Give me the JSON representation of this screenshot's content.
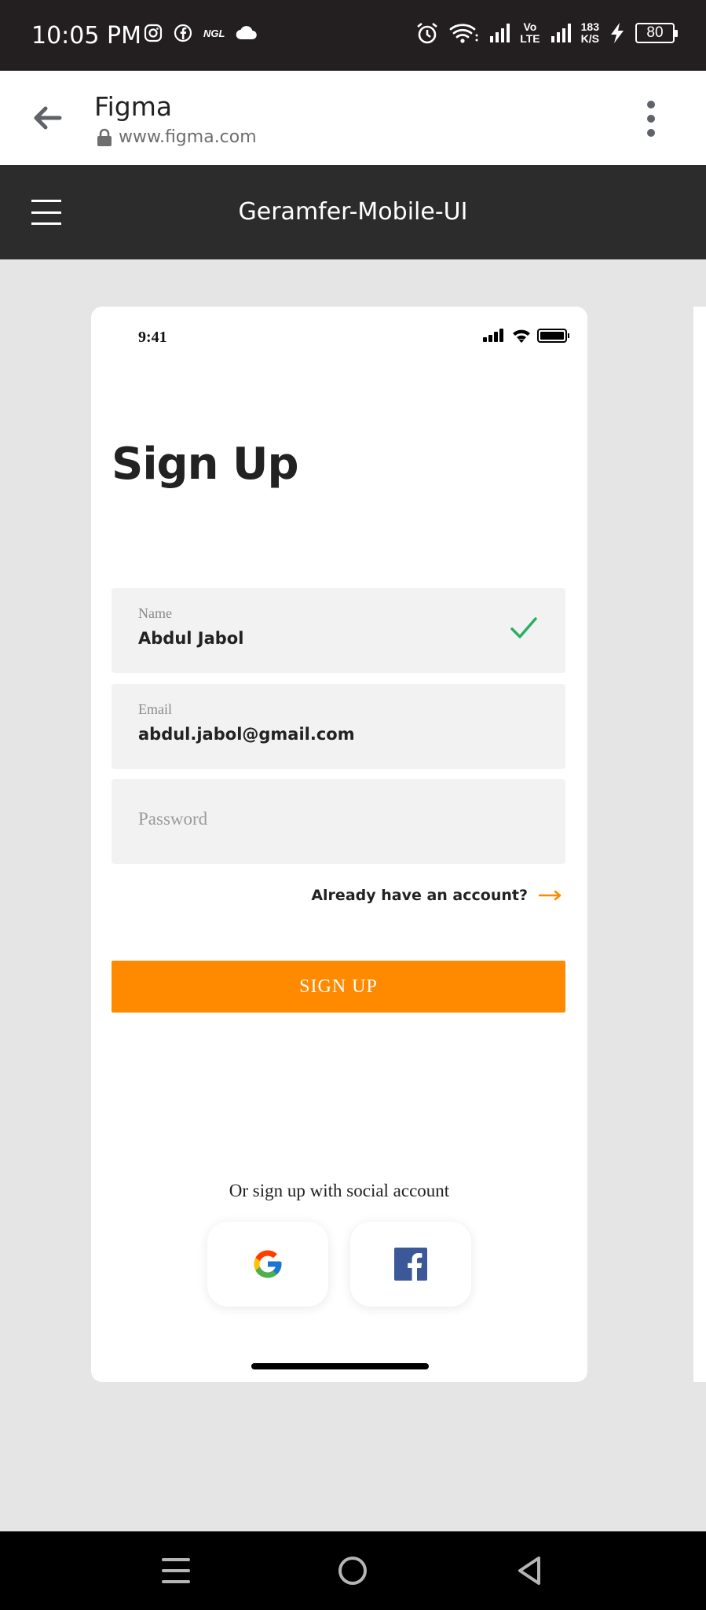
{
  "status_bar": {
    "time": "10:05 PM",
    "left_icons": [
      "instagram-icon",
      "facebook-icon",
      "ngl-icon",
      "cloud-icon"
    ],
    "ngl_text": "NGL",
    "volte_top": "Vo",
    "volte_bottom": "LTE",
    "speed_value": "183",
    "speed_unit": "K/S",
    "battery": "80"
  },
  "browser": {
    "title": "Figma",
    "url": "www.figma.com"
  },
  "figma_toolbar": {
    "file_name": "Geramfer-Mobile-UI"
  },
  "phone": {
    "status_time": "9:41",
    "title": "Sign Up",
    "fields": {
      "name": {
        "label": "Name",
        "value": "Abdul Jabol",
        "valid": true
      },
      "email": {
        "label": "Email",
        "value": "abdul.jabol@gmail.com"
      },
      "password": {
        "placeholder": "Password"
      }
    },
    "already_account": "Already have an account?",
    "signup_button": "SIGN UP",
    "social_caption": "Or sign up with social account",
    "social": [
      "google-icon",
      "facebook-icon"
    ]
  },
  "colors": {
    "accent": "#ff8a00",
    "check": "#27ae60",
    "facebook": "#3b5998",
    "toolbar": "#2c2c2c"
  }
}
